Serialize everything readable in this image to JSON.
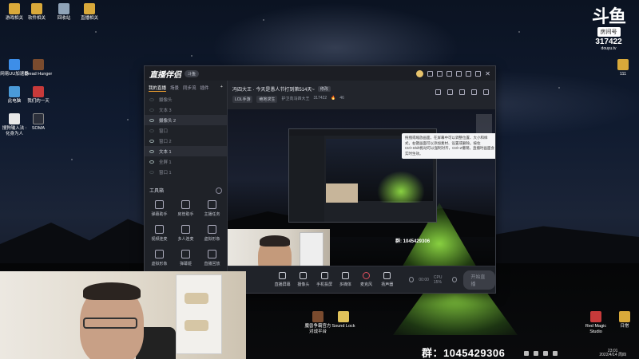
{
  "desktop": {
    "icons_top": [
      "游戏相关",
      "软件相关",
      "回收站",
      "直播相关"
    ],
    "icons_left": [
      {
        "label": "网易UU加速器",
        "icon": "network-icon"
      },
      {
        "label": "Dread Hunger",
        "icon": "game-icon"
      },
      {
        "label": "此电脑",
        "icon": "computer-icon"
      },
      {
        "label": "我们的一天",
        "icon": "app-icon"
      },
      {
        "label": "搜狗输入法 : 化身为人",
        "icon": "headset-icon"
      },
      {
        "label": "SOMA",
        "icon": "game-icon"
      }
    ],
    "icons_bottom": [
      {
        "label": "魔兽争霸官方对战平台",
        "icon": "game-icon"
      },
      {
        "label": "Sound Lock",
        "icon": "lock-icon"
      },
      {
        "label": "Red Magic Studio",
        "icon": "app-icon"
      },
      {
        "label": "日常",
        "icon": "folder-icon"
      }
    ],
    "right_label": "111"
  },
  "douyu": {
    "logo": "斗鱼",
    "room_label": "房间号",
    "room_id": "317422",
    "url": "douyu.tv"
  },
  "app": {
    "brand": "直播伴侣",
    "brand_tag": "斗鱼",
    "left_tabs": [
      "我的直播",
      "场景",
      "同步流",
      "插件"
    ],
    "scenes": [
      {
        "label": "摄像头",
        "visible": false
      },
      {
        "label": "文本 3",
        "visible": false
      },
      {
        "label": "摄像头 2",
        "visible": true
      },
      {
        "label": "窗口",
        "visible": false
      },
      {
        "label": "窗口 2",
        "visible": true
      },
      {
        "label": "文本 1",
        "visible": true
      },
      {
        "label": "全屏 1",
        "visible": true
      },
      {
        "label": "窗口 1",
        "visible": false
      }
    ],
    "tools_title": "工具箱",
    "tools": [
      "弹幕助手",
      "房管助手",
      "主播任务",
      "视频连麦",
      "多人连麦",
      "虚拟形象",
      "虚拟形象",
      "弹幕姬",
      "直播回放"
    ],
    "room_title": "冯四大王 · 今天是愚人节打到第514天~",
    "room_title_tag": "修改",
    "room_sub_pills": [
      "LOL手游",
      "绝地求生"
    ],
    "room_sub": [
      "护卫向冯四大王",
      "317422"
    ],
    "room_sub_count": "46",
    "tooltip": "拖拽或缩放画面，在屏幕中可以调整位置、大小和样式，右键画面可以添加素材、设置或删除。按住Ctrl+Shift拖动可以强制对齐，Ctrl+Z撤销，直播时画面会实时生效。",
    "qq_group_small": "群: 1045429306",
    "bottom_buttons": [
      {
        "label": "直播屏幕",
        "icon": "screen-icon"
      },
      {
        "label": "摄像头",
        "icon": "camera-icon"
      },
      {
        "label": "手机投屏",
        "icon": "phone-icon"
      },
      {
        "label": "多媒体",
        "icon": "media-icon"
      },
      {
        "label": "麦克风",
        "icon": "mic-icon"
      },
      {
        "label": "扬声器",
        "icon": "speaker-icon"
      }
    ],
    "bottom_stats": [
      "00:00",
      "CPU 15%"
    ],
    "start_label": "开始直播"
  },
  "overlay": {
    "qq_group": "群：1045429306"
  },
  "taskbar": {
    "time": "23:01",
    "date": "2022/4/14 周四"
  }
}
